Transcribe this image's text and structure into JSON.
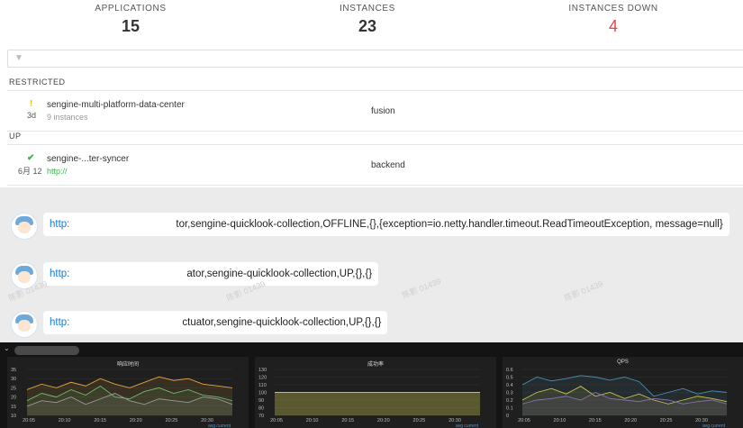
{
  "stats": {
    "applications": {
      "label": "APPLICATIONS",
      "value": "15"
    },
    "instances": {
      "label": "INSTANCES",
      "value": "23"
    },
    "instances_down": {
      "label": "INSTANCES DOWN",
      "value": "4"
    }
  },
  "filter": {
    "icon": "filter-icon",
    "placeholder": ""
  },
  "sections": {
    "restricted": {
      "label": "RESTRICTED",
      "rows": [
        {
          "status_icon": "warning-icon",
          "ago": "3d",
          "name": "sengine-multi-platform-data-center",
          "sub": "9 instances",
          "group": "fusion"
        }
      ]
    },
    "up": {
      "label": "UP",
      "rows": [
        {
          "status_icon": "check-icon",
          "ago": "6月 12",
          "name": "sengine-...ter-syncer",
          "sub": "http://",
          "group": "backend"
        }
      ]
    }
  },
  "messages": [
    {
      "url": "http:",
      "text": "tor,sengine-quicklook-collection,OFFLINE,{},{exception=io.netty.handler.timeout.ReadTimeoutException, message=null}"
    },
    {
      "url": "http:",
      "text": "ator,sengine-quicklook-collection,UP,{},{}"
    },
    {
      "url": "http:",
      "text": "ctuator,sengine-quicklook-collection,UP,{},{}"
    }
  ],
  "watermarks": [
    "陈影 01439",
    "陈影 01439",
    "陈影 01439",
    "陈影 01439"
  ],
  "colors": {
    "down": "#e8414e",
    "link": "#1a7ad4",
    "up_green": "#3fb24f"
  },
  "chart_data": [
    {
      "type": "line",
      "title": "响应时间",
      "x": [
        "20:05",
        "20:10",
        "20:15",
        "20:20",
        "20:25",
        "20:30"
      ],
      "ylim": [
        10,
        35
      ],
      "yticks": [
        "35",
        "30",
        "25",
        "20",
        "15",
        "10"
      ],
      "series": [
        {
          "color": "#e8a33d",
          "values": [
            24,
            27,
            25,
            28,
            26,
            30,
            27,
            25,
            28,
            31,
            29,
            30,
            27,
            26,
            25
          ]
        },
        {
          "color": "#6fb86f",
          "values": [
            18,
            22,
            20,
            24,
            21,
            26,
            20,
            19,
            23,
            25,
            22,
            24,
            21,
            20,
            18
          ]
        },
        {
          "color": "#9a9a9a",
          "values": [
            15,
            18,
            17,
            20,
            16,
            19,
            22,
            18,
            16,
            19,
            18,
            17,
            20,
            19,
            16
          ]
        }
      ],
      "legend": [
        "avg",
        "current"
      ]
    },
    {
      "type": "area",
      "title": "成功率",
      "x": [
        "20:05",
        "20:10",
        "20:15",
        "20:20",
        "20:25",
        "20:30"
      ],
      "ylim": [
        70,
        130
      ],
      "yticks": [
        "130",
        "120",
        "110",
        "100",
        "90",
        "80",
        "70"
      ],
      "series": [
        {
          "color": "#c9c34a",
          "values": [
            100,
            100,
            100,
            100,
            100,
            100,
            100,
            100,
            100,
            100,
            100,
            100,
            100,
            100,
            100
          ]
        }
      ],
      "legend": [
        "avg",
        "current"
      ]
    },
    {
      "type": "line",
      "title": "QPS",
      "x": [
        "20:05",
        "20:10",
        "20:15",
        "20:20",
        "20:25",
        "20:30"
      ],
      "ylim": [
        0,
        0.6
      ],
      "yticks": [
        "0.6",
        "0.5",
        "0.4",
        "0.3",
        "0.2",
        "0.1",
        "0"
      ],
      "series": [
        {
          "color": "#4a8fb0",
          "values": [
            0.4,
            0.5,
            0.45,
            0.48,
            0.52,
            0.5,
            0.46,
            0.5,
            0.44,
            0.25,
            0.3,
            0.35,
            0.28,
            0.32,
            0.3
          ]
        },
        {
          "color": "#c9c34a",
          "values": [
            0.2,
            0.3,
            0.35,
            0.28,
            0.38,
            0.25,
            0.3,
            0.22,
            0.28,
            0.2,
            0.15,
            0.2,
            0.25,
            0.22,
            0.18
          ]
        },
        {
          "color": "#8a6fb0",
          "values": [
            0.15,
            0.2,
            0.22,
            0.25,
            0.2,
            0.3,
            0.22,
            0.2,
            0.18,
            0.22,
            0.2,
            0.15,
            0.18,
            0.2,
            0.15
          ]
        }
      ],
      "legend": [
        "avg",
        "current"
      ]
    }
  ]
}
